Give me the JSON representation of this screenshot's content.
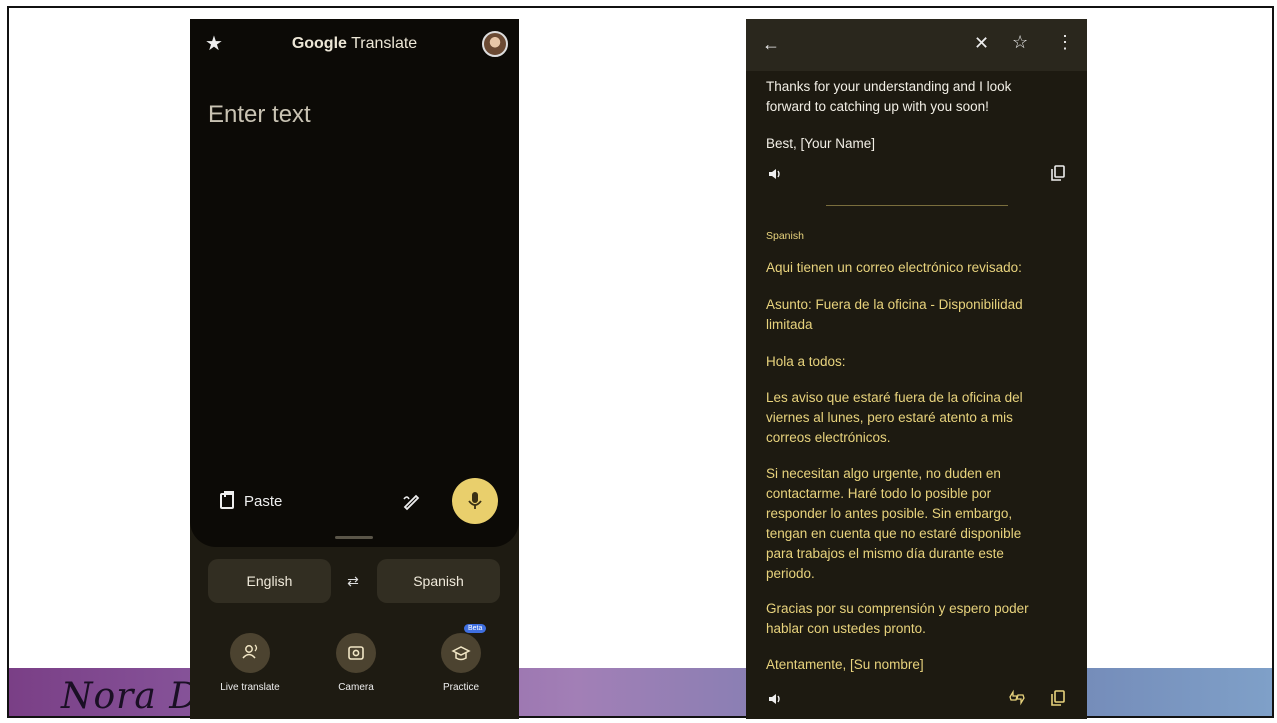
{
  "footer": {
    "author": "Nora D"
  },
  "phone1": {
    "app_title_brand": "Google",
    "app_title_rest": " Translate",
    "input_placeholder": "Enter text",
    "paste_label": "Paste",
    "source_language": "English",
    "target_language": "Spanish",
    "features": [
      {
        "label": "Live translate",
        "icon": "live-translate-icon"
      },
      {
        "label": "Camera",
        "icon": "camera-icon"
      },
      {
        "label": "Practice",
        "icon": "practice-icon",
        "badge": "Beta"
      }
    ],
    "colors": {
      "accent": "#e9cf6c",
      "panel": "#0c0a06",
      "background": "#1e1b12"
    }
  },
  "phone2": {
    "source_text": [
      "Thanks for your understanding and I look",
      "forward to catching up with you soon!",
      "Best, [Your Name]"
    ],
    "target_language_label": "Spanish",
    "translation": [
      "Aqui tienen un correo electrónico revisado:",
      "Asunto: Fuera de la oficina - Disponibilidad",
      "limitada",
      "Hola a todos:",
      "Les aviso que estaré fuera de la oficina del",
      "viernes al lunes, pero estaré atento a mis",
      "correos electrónicos.",
      "Si necesitan algo urgente, no duden en",
      "contactarme. Haré todo lo posible por",
      "responder lo antes posible. Sin embargo,",
      "tengan en cuenta que no estaré disponible",
      "para trabajos el mismo día durante este",
      "periodo.",
      "Gracias por su comprensión y espero poder",
      "hablar con ustedes pronto.",
      "Atentamente, [Su nombre]"
    ],
    "colors": {
      "translation_text": "#e8d37d",
      "header": "#2a271d"
    }
  }
}
